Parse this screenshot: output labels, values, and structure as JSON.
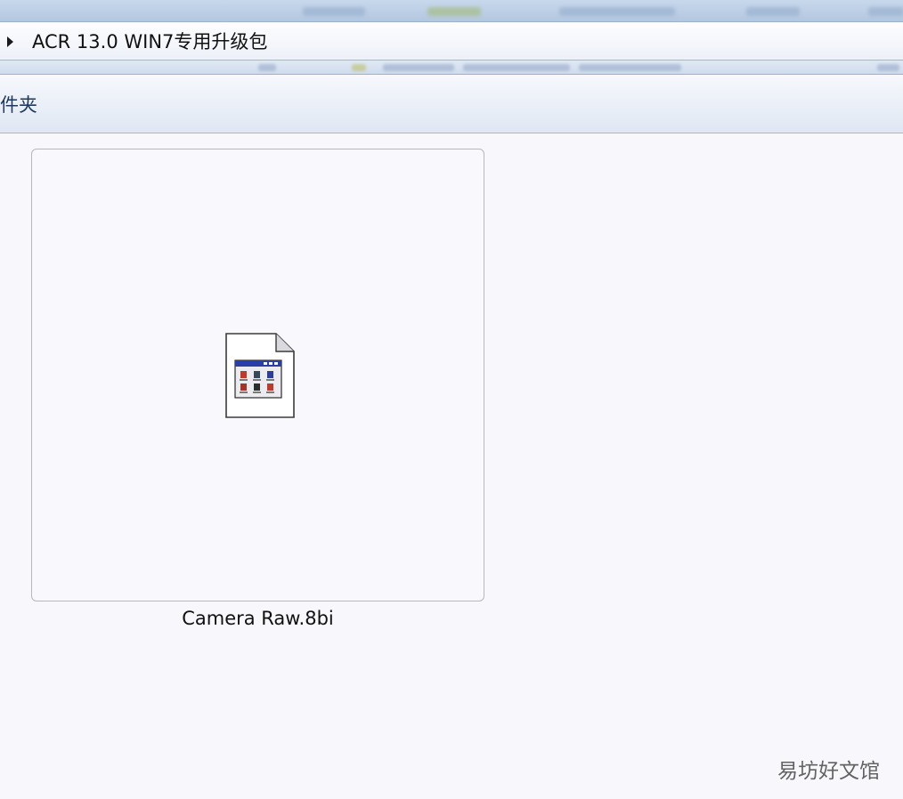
{
  "address_bar": {
    "path": "ACR 13.0 WIN7专用升级包",
    "arrow_icon": "triangle-right-icon"
  },
  "folder_header": {
    "title": "件夹"
  },
  "files": [
    {
      "name": "Camera Raw.8bi",
      "icon": "plugin-file-icon",
      "selected": true
    }
  ],
  "watermark": "易坊好文馆",
  "colors": {
    "background": "#f8f7fb",
    "header_text": "#1e395b",
    "chrome_blue": "#b3c7e0",
    "icon_window_blue": "#2a3ea8",
    "icon_accent_red": "#c0392b"
  }
}
